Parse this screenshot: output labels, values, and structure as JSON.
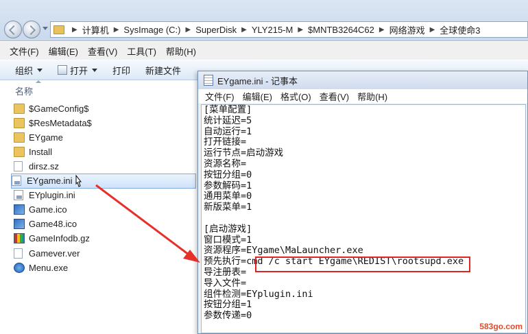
{
  "address": {
    "crumbs": [
      "计算机",
      "SysImage (C:)",
      "SuperDisk",
      "YLY215-M",
      "$MNTB3264C62",
      "网络游戏",
      "全球使命3"
    ]
  },
  "explorer_menu": [
    "文件(F)",
    "编辑(E)",
    "查看(V)",
    "工具(T)",
    "帮助(H)"
  ],
  "toolbar": {
    "organize": "组织",
    "open": "打开",
    "print": "打印",
    "newfolder": "新建文件"
  },
  "filelist": {
    "column_name": "名称",
    "items": [
      {
        "name": "$GameConfig$",
        "icon": "folder-icon"
      },
      {
        "name": "$ResMetadata$",
        "icon": "folder-icon"
      },
      {
        "name": "EYgame",
        "icon": "folder-icon"
      },
      {
        "name": "Install",
        "icon": "folder-icon"
      },
      {
        "name": "dirsz.sz",
        "icon": "file-icon"
      },
      {
        "name": "EYgame.ini",
        "icon": "ini-file-icon",
        "selected": true
      },
      {
        "name": "EYplugin.ini",
        "icon": "ini-file-icon"
      },
      {
        "name": "Game.ico",
        "icon": "game-icon"
      },
      {
        "name": "Game48.ico",
        "icon": "game-icon"
      },
      {
        "name": "GameInfodb.gz",
        "icon": "archive-icon"
      },
      {
        "name": "Gamever.ver",
        "icon": "file-icon"
      },
      {
        "name": "Menu.exe",
        "icon": "exe-icon"
      }
    ]
  },
  "notepad": {
    "title": "EYgame.ini - 记事本",
    "menu": [
      "文件(F)",
      "编辑(E)",
      "格式(O)",
      "查看(V)",
      "帮助(H)"
    ],
    "lines": [
      "[菜单配置]",
      "统计延迟=5",
      "自动运行=1",
      "打开链接=",
      "运行节点=启动游戏",
      "资源名称=",
      "按钮分组=0",
      "参数解码=1",
      "通用菜单=0",
      "新版菜单=1",
      "",
      "[启动游戏]",
      "窗口模式=1",
      "资源程序=EYgame\\MaLauncher.exe",
      "预先执行=cmd /c start EYgame\\REDIST\\rootsupd.exe",
      "导注册表=",
      "导入文件=",
      "组件检测=EYplugin.ini",
      "按钮分组=1",
      "参数传递=0"
    ]
  },
  "watermark": "583go.com",
  "colors": {
    "highlight": "#e02424",
    "arrow": "#e8302a"
  }
}
